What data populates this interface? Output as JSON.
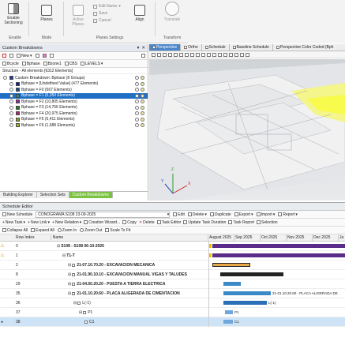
{
  "ribbon": {
    "enable_sectioning": "Enable\nSectioning",
    "planes": "Planes",
    "active_planes": "Active\nPlanes",
    "edit_name": "Edit Name",
    "save": "Save",
    "cancel": "Cancel",
    "align": "Align",
    "translate": "Translate",
    "group_enable": "Enable",
    "group_mode": "Mode",
    "group_planes_settings": "Planes Settings",
    "group_transform": "Transform"
  },
  "breakdowns": {
    "title": "Custom Breakdowns",
    "new_label": "New",
    "tb2": [
      "Bcycle",
      "Bphase",
      "Bzone1",
      "CBS",
      "LEVELS"
    ],
    "structure_label": "Structure - All elements [6312 Elements]",
    "tree": [
      {
        "label": "Custom Breakdown: Bphase (8 Groups)",
        "color": "#2a3a9c",
        "level": 0
      },
      {
        "label": "Bphase = [Undefined Value] (477 Elements)",
        "color": "#1d1d8a",
        "level": 1
      },
      {
        "label": "Bphase = F0 (567 Elements)",
        "color": "#1e4f8f",
        "level": 1
      },
      {
        "label": "Bphase = F1 (5,350 Elements)",
        "color": "#2d8a8a",
        "level": 1
      },
      {
        "label": "Bphase = F2 (10,805 Elements)",
        "color": "#8a2ba0",
        "level": 1
      },
      {
        "label": "Bphase = F3 (14,756 Elements)",
        "color": "#2a7a2a",
        "level": 1
      },
      {
        "label": "Bphase = F4 (20,975 Elements)",
        "color": "#a02a6a",
        "level": 1
      },
      {
        "label": "Bphase = F5 (5,411 Elements)",
        "color": "#8a9c2a",
        "level": 1
      },
      {
        "label": "Bphase = F6 (1,688 Elements)",
        "color": "#9ab838",
        "level": 1
      }
    ],
    "bottom_tabs": [
      "Building Explorer",
      "Selection Sets",
      "Custom Breakdowns"
    ]
  },
  "viewer": {
    "tabs": [
      "Perspective",
      "Ortho",
      "Schedule",
      "Baseline Schedule",
      "Perspective Color Coded (Bph"
    ],
    "axis_x": "X",
    "axis_y": "Y",
    "axis_z": "Z"
  },
  "schedule": {
    "title": "Schedule Editor",
    "new_schedule": "New Schedule",
    "schedule_name": "CONOGRAMA S108 23-09-2025",
    "edit": "Edit",
    "delete": "Delete",
    "duplicate": "Duplicate",
    "export": "Export",
    "import": "Import",
    "report": "Report",
    "tb2": [
      "New Task",
      "New Link",
      "New Relation",
      "Creation Wizard...",
      "Copy",
      "Delete",
      "Task Editor",
      "Update Task Duration",
      "Task Report",
      "Selection"
    ],
    "tb3": [
      "Collapse All",
      "Expand All",
      "Zoom In",
      "Zoom Out",
      "Scale To Fit"
    ],
    "col_row": "Row Index",
    "col_name": "Name",
    "months": [
      "August 2025",
      "Sep 2025",
      "Oct 2025",
      "Nov 2025",
      "Dec 2025",
      "Ja"
    ],
    "rows": [
      {
        "idx": "0",
        "name": "S108 - S108 06-10-2025",
        "bold": true,
        "warn": true,
        "indent": 0
      },
      {
        "idx": "1",
        "name": "T1-T",
        "bold": true,
        "warn": true,
        "indent": 1
      },
      {
        "idx": "2",
        "name": "21-07.10.70.20 - EXCAVACION MECANICA",
        "bold": true,
        "warn": false,
        "indent": 2
      },
      {
        "idx": "8",
        "name": "21-01.90.10.10 - EXCAVACION MANUAL VIGAS Y TALUDES",
        "bold": true,
        "warn": false,
        "indent": 2
      },
      {
        "idx": "29",
        "name": "21-04.50.20.20 - PUESTA A TIERRA ELECTRICA",
        "bold": true,
        "warn": false,
        "indent": 2
      },
      {
        "idx": "35",
        "name": "21-01.10.20.60 - PLACA ALIGERADA DE CIMENTACION",
        "bold": true,
        "warn": false,
        "indent": 2
      },
      {
        "idx": "36",
        "name": "L(-1)",
        "bold": false,
        "warn": false,
        "indent": 3
      },
      {
        "idx": "37",
        "name": "P1",
        "bold": false,
        "warn": false,
        "indent": 4
      },
      {
        "idx": "38",
        "name": "C1",
        "bold": false,
        "warn": false,
        "indent": 5
      }
    ],
    "bar_label_35": "21-01.10.20.60 - PLACA ALIGERADA DE",
    "bar_label_36": "L(-1)",
    "bar_label_37": "P1",
    "bar_label_38": "C1"
  }
}
